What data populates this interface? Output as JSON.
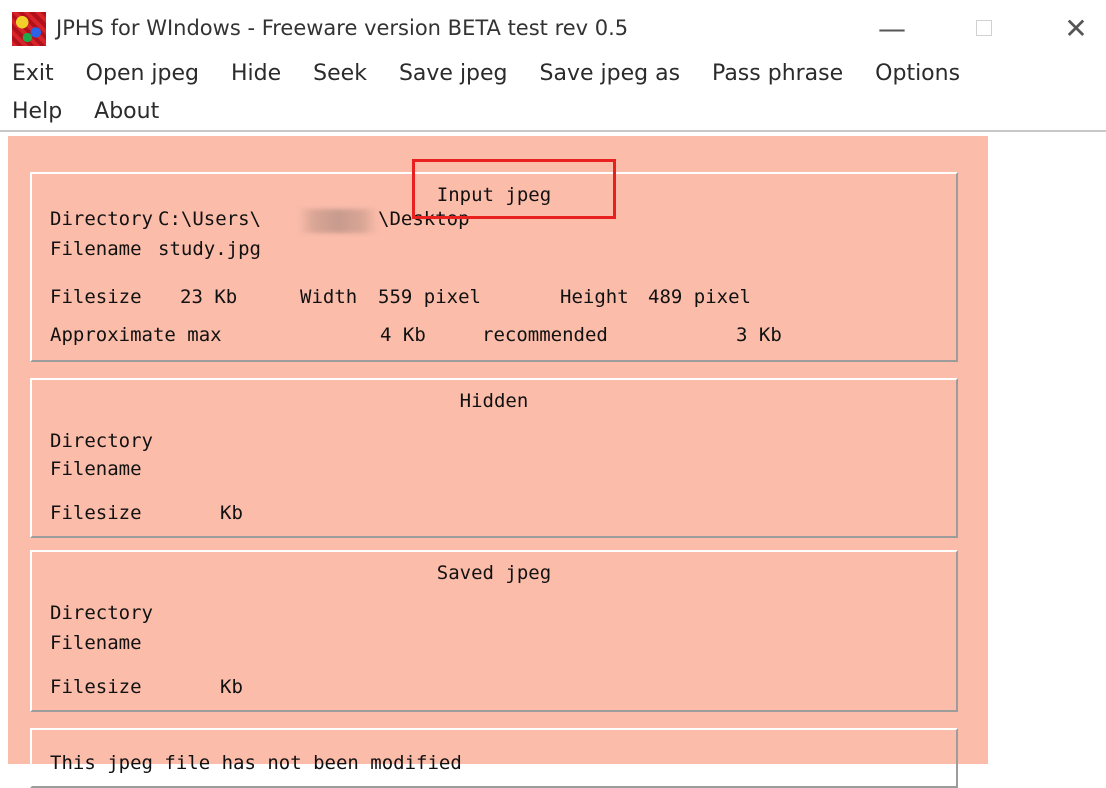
{
  "window": {
    "title": "JPHS for WIndows - Freeware version BETA test rev 0.5",
    "minimize_glyph": "—",
    "close_glyph": "✕"
  },
  "menu": {
    "row1": [
      "Exit",
      "Open jpeg",
      "Hide",
      "Seek",
      "Save jpeg",
      "Save jpeg as",
      "Pass phrase",
      "Options"
    ],
    "row2": [
      "Help",
      "About"
    ]
  },
  "input_jpeg": {
    "title": "Input jpeg",
    "directory_label": "Directory",
    "directory_value": "C:\\Users\\",
    "directory_value_tail": "\\Desktop",
    "filename_label": "Filename",
    "filename_value": "study.jpg",
    "filesize_label": "Filesize",
    "filesize_value": "23 Kb",
    "width_label": "Width",
    "width_value": "559 pixel",
    "height_label": "Height",
    "height_value": "489 pixel",
    "approx_label": "Approximate max",
    "approx_value": "4 Kb",
    "recommended_label": "recommended",
    "recommended_value": "3 Kb"
  },
  "hidden": {
    "title": "Hidden",
    "directory_label": "Directory",
    "filename_label": "Filename",
    "filesize_label": "Filesize",
    "filesize_unit": "Kb"
  },
  "saved_jpeg": {
    "title": "Saved jpeg",
    "directory_label": "Directory",
    "filename_label": "Filename",
    "filesize_label": "Filesize",
    "filesize_unit": "Kb"
  },
  "status": {
    "message": "This jpeg file has not been modified"
  },
  "colors": {
    "client_bg": "#fbbcaa",
    "highlight": "#e8201e"
  }
}
